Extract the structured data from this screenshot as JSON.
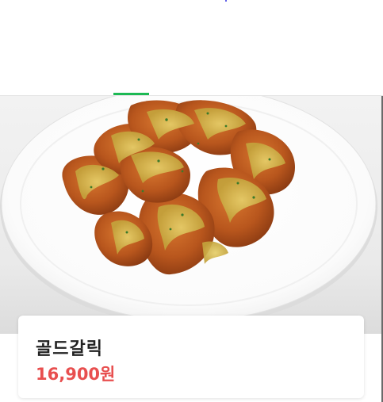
{
  "header": {
    "active_tab_color": "#1db954"
  },
  "product": {
    "image_icon": "fried-chicken-photo",
    "name": "골드갈릭",
    "price": "16,900원",
    "price_color": "#e84f4f"
  }
}
